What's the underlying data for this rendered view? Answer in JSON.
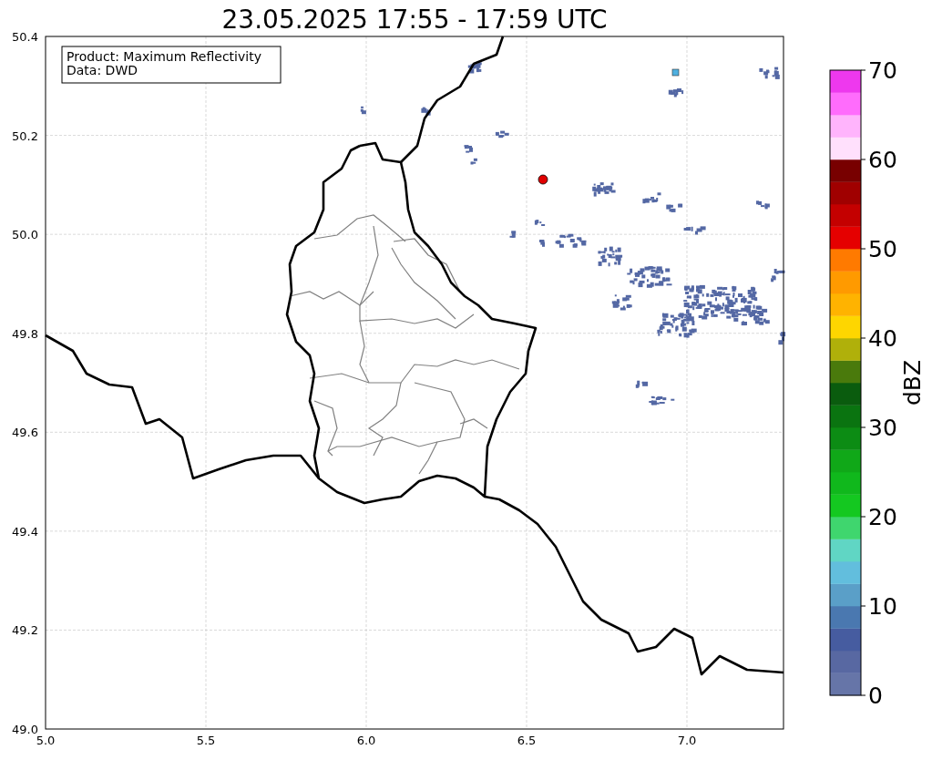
{
  "title": "23.05.2025 17:55 - 17:59 UTC",
  "info_box": {
    "lines": [
      "Product: Maximum Reflectivity",
      "Data: DWD"
    ]
  },
  "x_axis": {
    "ticks": [
      "5.0",
      "5.5",
      "6.0",
      "6.5",
      "7.0"
    ]
  },
  "y_axis": {
    "ticks": [
      "50.4",
      "50.2",
      "50.0",
      "49.8",
      "49.6",
      "49.4",
      "49.2",
      "49.0"
    ]
  },
  "colorbar": {
    "label": "dBZ",
    "ticks": [
      "70",
      "60",
      "50",
      "40",
      "30",
      "20",
      "10",
      "0"
    ],
    "bands": [
      {
        "color": "#6675a8"
      },
      {
        "color": "#5868a2"
      },
      {
        "color": "#465ca0"
      },
      {
        "color": "#4a78b0"
      },
      {
        "color": "#5a9fc8"
      },
      {
        "color": "#62bedd"
      },
      {
        "color": "#60d6c4"
      },
      {
        "color": "#3fd66e"
      },
      {
        "color": "#14c820"
      },
      {
        "color": "#10b81c"
      },
      {
        "color": "#10a818"
      },
      {
        "color": "#0c8c14"
      },
      {
        "color": "#0a7410"
      },
      {
        "color": "#0a5c0e"
      },
      {
        "color": "#4a7a0c"
      },
      {
        "color": "#b0b00a"
      },
      {
        "color": "#fed600"
      },
      {
        "color": "#ffb300"
      },
      {
        "color": "#ff9a00"
      },
      {
        "color": "#ff7a00"
      },
      {
        "color": "#e50000"
      },
      {
        "color": "#c40000"
      },
      {
        "color": "#a00000"
      },
      {
        "color": "#780000"
      },
      {
        "color": "#ffe0fc"
      },
      {
        "color": "#ffb4fc"
      },
      {
        "color": "#ff6cfc"
      },
      {
        "color": "#ee38ee"
      }
    ]
  }
}
